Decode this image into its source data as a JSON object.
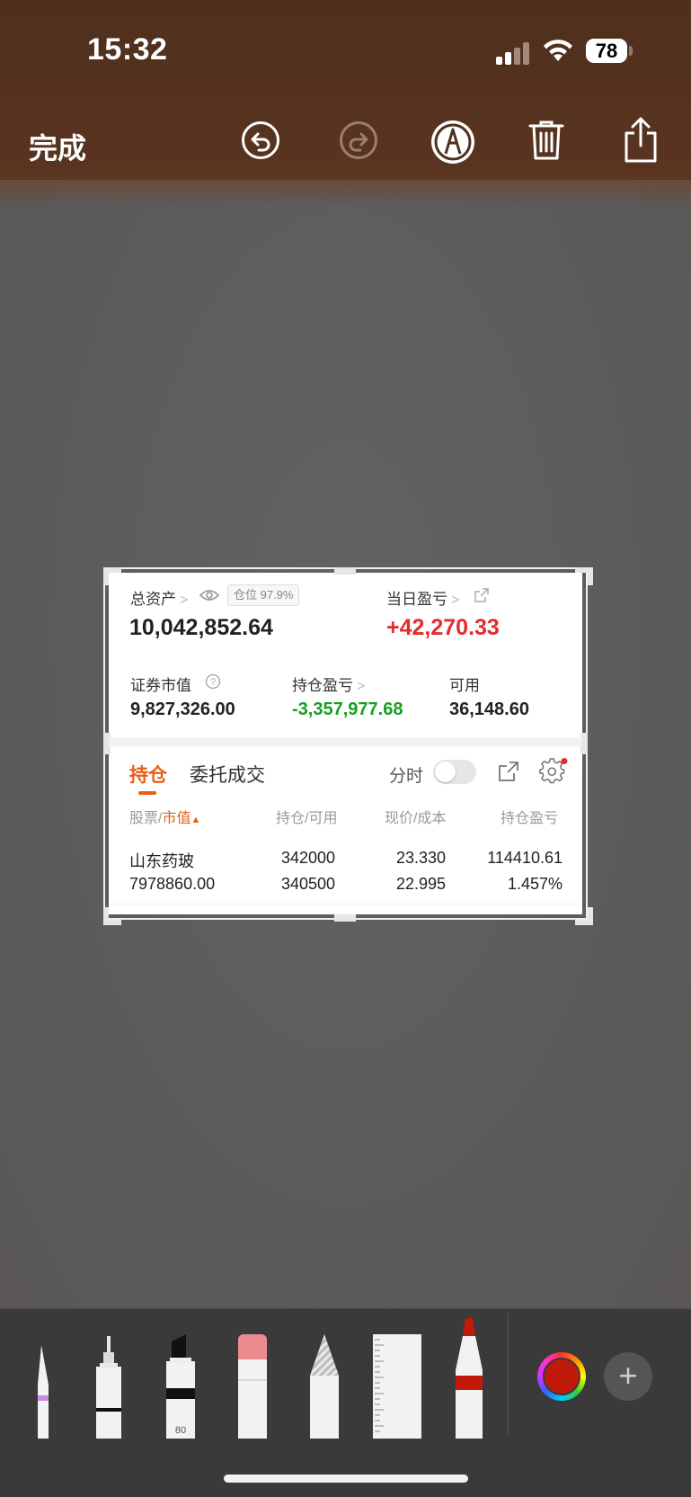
{
  "status_bar": {
    "time": "15:32",
    "battery": "78"
  },
  "toolbar": {
    "done_label": "完成"
  },
  "card": {
    "total_assets_label": "总资产",
    "position_badge": "仓位 97.9%",
    "total_assets_value": "10,042,852.64",
    "daily_pnl_label": "当日盈亏",
    "daily_pnl_value": "+42,270.33",
    "market_value_label": "证券市值",
    "market_value": "9,827,326.00",
    "holding_pnl_label": "持仓盈亏",
    "holding_pnl_value": "-3,357,977.68",
    "available_label": "可用",
    "available_value": "36,148.60",
    "tabs": [
      {
        "label": "持仓"
      },
      {
        "label": "委托成交"
      }
    ],
    "intraday_label": "分时",
    "columns": {
      "stock": "股票",
      "slash": "/",
      "market_value": "市值",
      "holding": "持仓/可用",
      "price": "现价/成本",
      "pnl": "持仓盈亏"
    },
    "row": {
      "name": "山东药玻",
      "market_value": "7978860.00",
      "holding": "342000",
      "available": "340500",
      "price": "23.330",
      "cost": "22.995",
      "pnl": "114410.61",
      "pnl_pct": "1.457%"
    }
  },
  "palette": {
    "marker_size": "80",
    "selected_color": "#c21a0a"
  }
}
